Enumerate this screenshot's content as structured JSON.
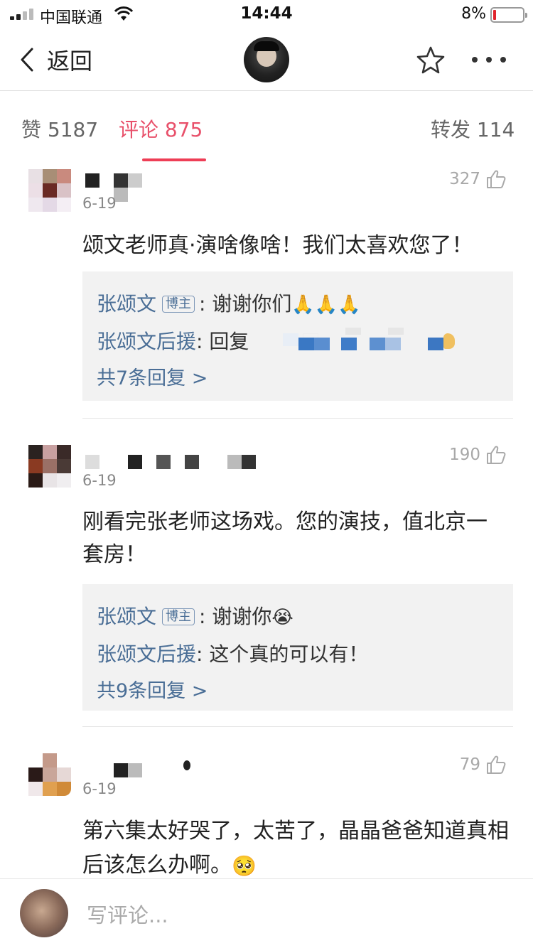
{
  "status_bar": {
    "carrier": "中国联通",
    "time": "14:44",
    "battery": "8%",
    "battery_level": 0.08,
    "battery_color": "#e0242c"
  },
  "nav": {
    "back_icon": "chevron-left-icon",
    "back_label": "返回",
    "star_icon": "star-icon",
    "more_icon": "more-dots-icon"
  },
  "tabs": {
    "likes": "赞 5187",
    "comments": "评论 875",
    "reposts": "转发 114",
    "active": "comments",
    "accent": "#ee3e56"
  },
  "comments": [
    {
      "date": "6-19",
      "likes": "327",
      "text": "颂文老师真·演啥像啥！我们太喜欢您了！",
      "replies": [
        {
          "name": "张颂文",
          "badge": "博主",
          "text": ": 谢谢你们",
          "emoji": "🙏🙏🙏"
        },
        {
          "name": "张颂文后援",
          "text": ": 回复"
        }
      ],
      "more": "共7条回复 >"
    },
    {
      "date": "6-19",
      "likes": "190",
      "text": "刚看完张老师这场戏。您的演技，值北京一套房！",
      "replies": [
        {
          "name": "张颂文",
          "badge": "博主",
          "text": ": 谢谢你",
          "emoji": "😭"
        },
        {
          "name": "张颂文后援",
          "text": ": 这个真的可以有！"
        }
      ],
      "more": "共9条回复 >"
    },
    {
      "date": "6-19",
      "likes": "79",
      "text": "第六集太好哭了，太苦了，晶晶爸爸知道真相后该怎么办啊。",
      "emoji": "🥺"
    }
  ],
  "bottom": {
    "placeholder": "写评论..."
  },
  "colors": {
    "link": "#4a6e96",
    "reply_bg": "#f2f2f2"
  }
}
